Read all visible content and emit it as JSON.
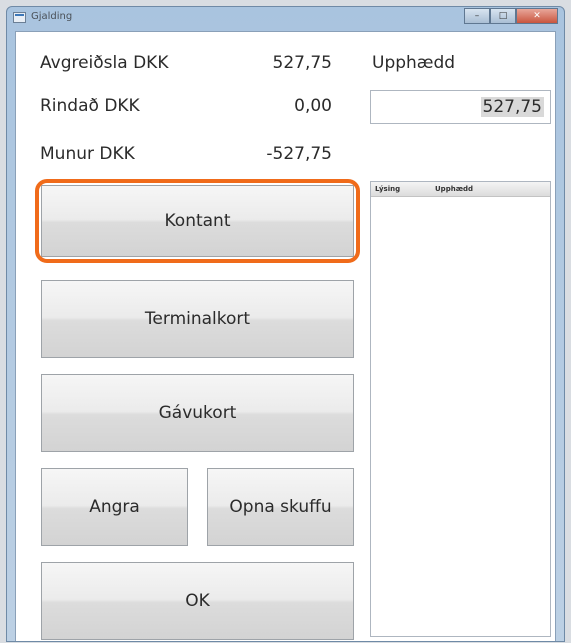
{
  "window": {
    "title": "Gjalding",
    "close_label": "✕"
  },
  "summary": {
    "rows": [
      {
        "label": "Avgreiðsla DKK",
        "value": "527,75"
      },
      {
        "label": "Rindað DKK",
        "value": "0,00"
      },
      {
        "label": "Munur DKK",
        "value": "-527,75"
      }
    ],
    "amount_label": "Upphædd",
    "amount_value": "527,75"
  },
  "payments_grid": {
    "columns": [
      "Lýsing",
      "Upphædd"
    ]
  },
  "buttons": {
    "cash": "Kontant",
    "terminal_card": "Terminalkort",
    "gift_card": "Gávukort",
    "undo": "Angra",
    "open_drawer": "Opna skuffu",
    "ok": "OK"
  },
  "colors": {
    "highlight": "#f06b1a",
    "titlebar": "#a9c4df"
  }
}
